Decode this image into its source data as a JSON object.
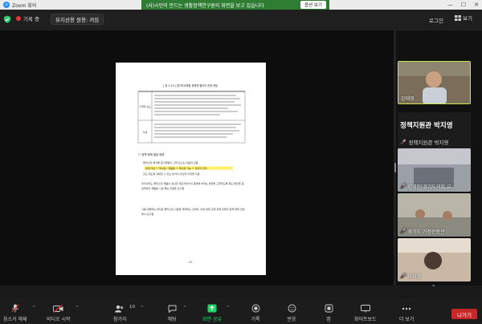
{
  "window": {
    "app_title": "Zoom 회의"
  },
  "banner": {
    "text": "(사)시민이 만드는 생활정책연구원의 화면을 보고 있습니다",
    "button": "옵션 보기"
  },
  "header": {
    "recording": "기록 중",
    "viewing": "뷰지션용 원용: 켜짐",
    "login": "로그인",
    "view": "보기"
  },
  "document": {
    "table_title": "[ 표 2-10 ] 경기도교육청 경제적 불이익 관계 개념",
    "row1_head": "기계적 보도",
    "row2_head": "사례",
    "section_heading": "□ 정책 형태 발달 배경",
    "para1": "플라스틱 폐기물 증가현황의 고려 요소는 다음과 같음",
    "highlight1": "환경 개선 + 재사용 / 재활용 + 재사용 가능 + 전면적 금지",
    "para2": "강도 제도를 강화할 수 있는 방식이 우선적 추천을 지원",
    "para3": "우리나라도 플라스틱 제품의 생산과 재조리방식의 환경에 비하는 방향을 고려하도록 제도 발전을 중심하면서 재활용 시설 확보 지원을 요구함",
    "para4": "각종 대체하는 방식은 플라스틱 사용을 억제하는 것이며, 이에 대한 규제 정책 유형이 정책 형태 전반에서 요구됨",
    "page_number": "- 22 -"
  },
  "participants": [
    {
      "name": "강태영",
      "muted": false,
      "bg": "#6e6250"
    },
    {
      "name": "정책지원관 박지영",
      "muted": true,
      "label_only": true,
      "big_name": "정책지원관 박지영"
    },
    {
      "name": "김영민(경기도의회 교...",
      "muted": true,
      "bg": "#7b7f86"
    },
    {
      "name": "경기도 가정순환관",
      "muted": true,
      "bg": "#9a9a92"
    },
    {
      "name": "이지영",
      "muted": true,
      "bg": "#8a6b5c"
    }
  ],
  "toolbar": {
    "mute": "음소거 해제",
    "video": "비디오 시작",
    "participants": "참가자",
    "participants_count": "10",
    "chat": "채팅",
    "share": "화면 공유",
    "record": "기록",
    "reactions": "반응",
    "apps": "앱",
    "whiteboard": "화이트보드",
    "more": "더 보기",
    "leave": "나가기"
  },
  "colors": {
    "share_green": "#23d16b",
    "leave_red": "#c62828",
    "banner_green": "#2e7d32",
    "highlight": "#fff06a"
  }
}
